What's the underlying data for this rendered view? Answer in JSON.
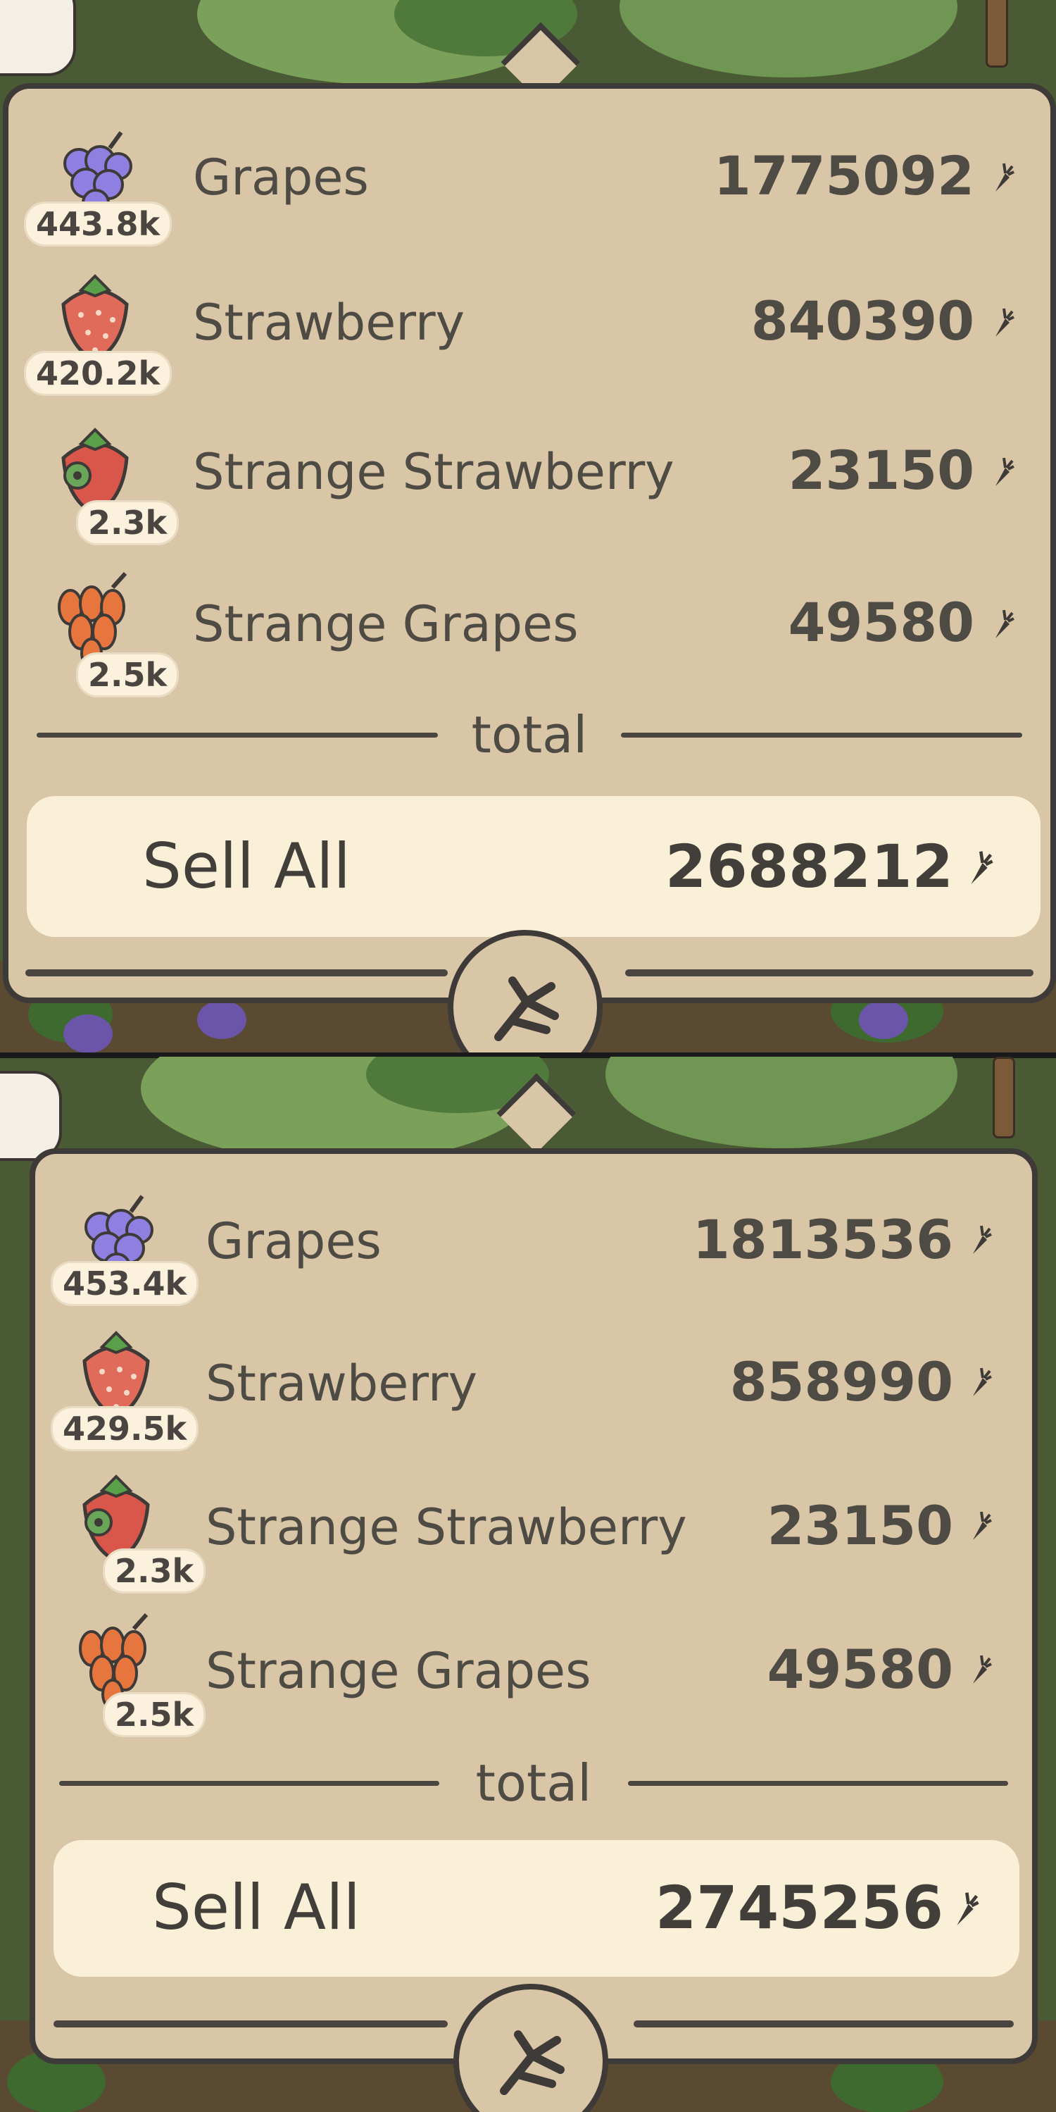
{
  "currency_icon": "carrot-icon",
  "colors": {
    "panel": "#d8c6a6",
    "border": "#3e3a37",
    "sell_button": "#faf0d8",
    "text": "#4e4a44"
  },
  "screens": [
    {
      "items": [
        {
          "name": "Grapes",
          "quantity": "443.8k",
          "price": "1775092",
          "icon": "grapes-icon"
        },
        {
          "name": "Strawberry",
          "quantity": "420.2k",
          "price": "840390",
          "icon": "strawberry-icon"
        },
        {
          "name": "Strange Strawberry",
          "quantity": "2.3k",
          "price": "23150",
          "icon": "strange-strawberry-icon"
        },
        {
          "name": "Strange Grapes",
          "quantity": "2.5k",
          "price": "49580",
          "icon": "strange-grapes-icon"
        }
      ],
      "total_label": "total",
      "sell_label": "Sell All",
      "sell_total": "2688212"
    },
    {
      "items": [
        {
          "name": "Grapes",
          "quantity": "453.4k",
          "price": "1813536",
          "icon": "grapes-icon"
        },
        {
          "name": "Strawberry",
          "quantity": "429.5k",
          "price": "858990",
          "icon": "strawberry-icon"
        },
        {
          "name": "Strange Strawberry",
          "quantity": "2.3k",
          "price": "23150",
          "icon": "strange-strawberry-icon"
        },
        {
          "name": "Strange Grapes",
          "quantity": "2.5k",
          "price": "49580",
          "icon": "strange-grapes-icon"
        }
      ],
      "total_label": "total",
      "sell_label": "Sell All",
      "sell_total": "2745256"
    }
  ]
}
